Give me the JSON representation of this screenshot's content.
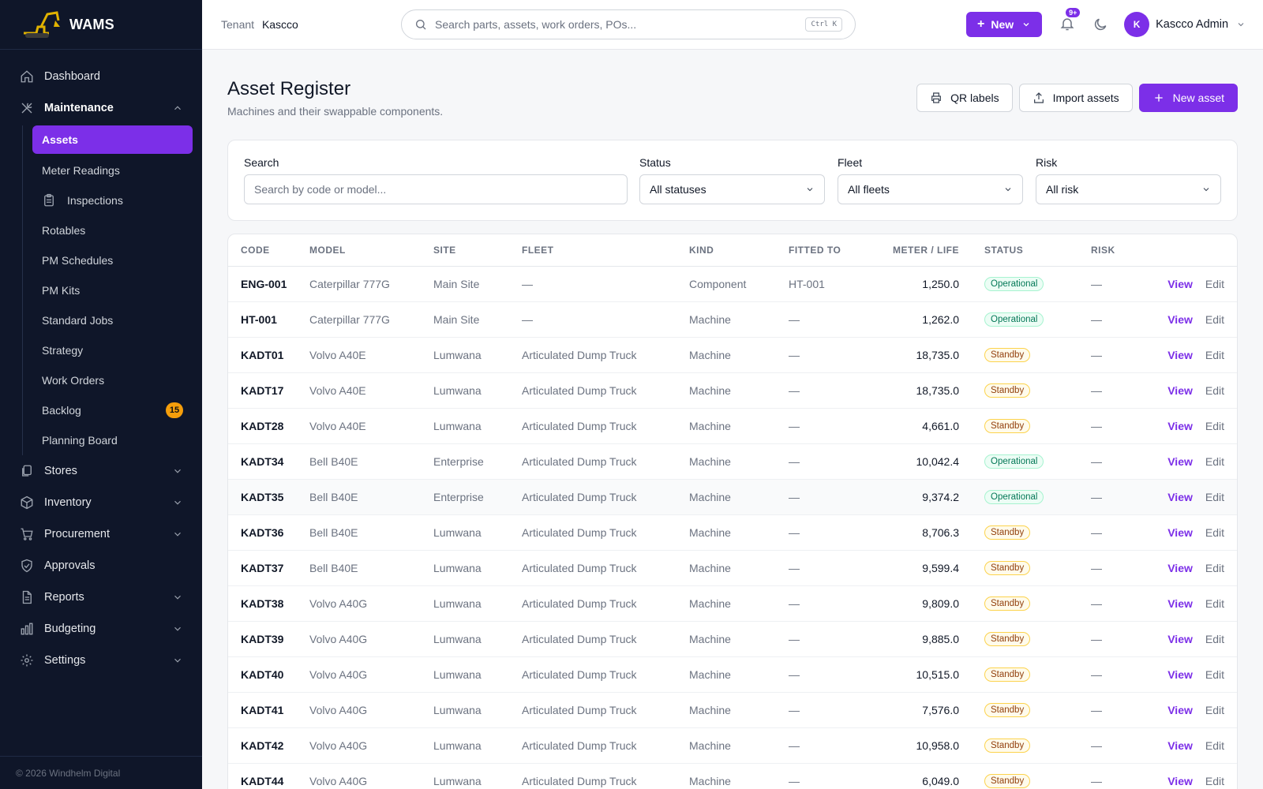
{
  "brand": {
    "name": "WAMS"
  },
  "sidebar": {
    "dashboard": "Dashboard",
    "maintenance": "Maintenance",
    "sub": [
      {
        "label": "Assets",
        "active": true
      },
      {
        "label": "Meter Readings"
      },
      {
        "label": "Inspections",
        "icon": "clipboard-icon"
      },
      {
        "label": "Rotables"
      },
      {
        "label": "PM Schedules"
      },
      {
        "label": "PM Kits"
      },
      {
        "label": "Standard Jobs"
      },
      {
        "label": "Strategy"
      },
      {
        "label": "Work Orders"
      },
      {
        "label": "Backlog",
        "badge": "15"
      },
      {
        "label": "Planning Board"
      }
    ],
    "sections": [
      {
        "label": "Stores",
        "icon": "files-icon"
      },
      {
        "label": "Inventory",
        "icon": "box-icon"
      },
      {
        "label": "Procurement",
        "icon": "cart-icon"
      },
      {
        "label": "Approvals",
        "icon": "shield-check-icon"
      },
      {
        "label": "Reports",
        "icon": "document-icon"
      },
      {
        "label": "Budgeting",
        "icon": "bar-chart-icon"
      },
      {
        "label": "Settings",
        "icon": "gear-icon"
      }
    ],
    "footer": "© 2026 Windhelm Digital"
  },
  "topbar": {
    "tenant_label": "Tenant",
    "tenant_name": "Kascco",
    "search_placeholder": "Search parts, assets, work orders, POs...",
    "shortcut": "Ctrl K",
    "new_label": "New",
    "notif_count": "9+",
    "avatar_initial": "K",
    "user_name": "Kascco Admin"
  },
  "page": {
    "title": "Asset Register",
    "subtitle": "Machines and their swappable components.",
    "qr_label": "QR labels",
    "import_label": "Import assets",
    "new_asset_label": "New asset"
  },
  "filters": {
    "search_label": "Search",
    "search_placeholder": "Search by code or model...",
    "status_label": "Status",
    "status_value": "All statuses",
    "fleet_label": "Fleet",
    "fleet_value": "All fleets",
    "risk_label": "Risk",
    "risk_value": "All risk"
  },
  "table": {
    "headers": {
      "code": "CODE",
      "model": "MODEL",
      "site": "SITE",
      "fleet": "FLEET",
      "kind": "KIND",
      "fitted": "FITTED TO",
      "meter": "METER / LIFE",
      "status": "STATUS",
      "risk": "RISK"
    },
    "view_label": "View",
    "edit_label": "Edit",
    "rows": [
      {
        "code": "ENG-001",
        "model": "Caterpillar 777G",
        "site": "Main Site",
        "fleet": "—",
        "kind": "Component",
        "fitted": "HT-001",
        "meter": "1,250.0",
        "status": "Operational",
        "risk": "—"
      },
      {
        "code": "HT-001",
        "model": "Caterpillar 777G",
        "site": "Main Site",
        "fleet": "—",
        "kind": "Machine",
        "fitted": "—",
        "meter": "1,262.0",
        "status": "Operational",
        "risk": "—"
      },
      {
        "code": "KADT01",
        "model": "Volvo A40E",
        "site": "Lumwana",
        "fleet": "Articulated Dump Truck",
        "kind": "Machine",
        "fitted": "—",
        "meter": "18,735.0",
        "status": "Standby",
        "risk": "—"
      },
      {
        "code": "KADT17",
        "model": "Volvo A40E",
        "site": "Lumwana",
        "fleet": "Articulated Dump Truck",
        "kind": "Machine",
        "fitted": "—",
        "meter": "18,735.0",
        "status": "Standby",
        "risk": "—"
      },
      {
        "code": "KADT28",
        "model": "Volvo A40E",
        "site": "Lumwana",
        "fleet": "Articulated Dump Truck",
        "kind": "Machine",
        "fitted": "—",
        "meter": "4,661.0",
        "status": "Standby",
        "risk": "—"
      },
      {
        "code": "KADT34",
        "model": "Bell B40E",
        "site": "Enterprise",
        "fleet": "Articulated Dump Truck",
        "kind": "Machine",
        "fitted": "—",
        "meter": "10,042.4",
        "status": "Operational",
        "risk": "—"
      },
      {
        "code": "KADT35",
        "model": "Bell B40E",
        "site": "Enterprise",
        "fleet": "Articulated Dump Truck",
        "kind": "Machine",
        "fitted": "—",
        "meter": "9,374.2",
        "status": "Operational",
        "risk": "—",
        "hover": true
      },
      {
        "code": "KADT36",
        "model": "Bell B40E",
        "site": "Lumwana",
        "fleet": "Articulated Dump Truck",
        "kind": "Machine",
        "fitted": "—",
        "meter": "8,706.3",
        "status": "Standby",
        "risk": "—"
      },
      {
        "code": "KADT37",
        "model": "Bell B40E",
        "site": "Lumwana",
        "fleet": "Articulated Dump Truck",
        "kind": "Machine",
        "fitted": "—",
        "meter": "9,599.4",
        "status": "Standby",
        "risk": "—"
      },
      {
        "code": "KADT38",
        "model": "Volvo A40G",
        "site": "Lumwana",
        "fleet": "Articulated Dump Truck",
        "kind": "Machine",
        "fitted": "—",
        "meter": "9,809.0",
        "status": "Standby",
        "risk": "—"
      },
      {
        "code": "KADT39",
        "model": "Volvo A40G",
        "site": "Lumwana",
        "fleet": "Articulated Dump Truck",
        "kind": "Machine",
        "fitted": "—",
        "meter": "9,885.0",
        "status": "Standby",
        "risk": "—"
      },
      {
        "code": "KADT40",
        "model": "Volvo A40G",
        "site": "Lumwana",
        "fleet": "Articulated Dump Truck",
        "kind": "Machine",
        "fitted": "—",
        "meter": "10,515.0",
        "status": "Standby",
        "risk": "—"
      },
      {
        "code": "KADT41",
        "model": "Volvo A40G",
        "site": "Lumwana",
        "fleet": "Articulated Dump Truck",
        "kind": "Machine",
        "fitted": "—",
        "meter": "7,576.0",
        "status": "Standby",
        "risk": "—"
      },
      {
        "code": "KADT42",
        "model": "Volvo A40G",
        "site": "Lumwana",
        "fleet": "Articulated Dump Truck",
        "kind": "Machine",
        "fitted": "—",
        "meter": "10,958.0",
        "status": "Standby",
        "risk": "—"
      },
      {
        "code": "KADT44",
        "model": "Volvo A40G",
        "site": "Lumwana",
        "fleet": "Articulated Dump Truck",
        "kind": "Machine",
        "fitted": "—",
        "meter": "6,049.0",
        "status": "Standby",
        "risk": "—"
      }
    ]
  },
  "colors": {
    "accent": "#7c2fe8",
    "sidebar_bg": "#0f1629",
    "operational": "#047857",
    "standby": "#92400e",
    "badge": "#f59e0b"
  }
}
